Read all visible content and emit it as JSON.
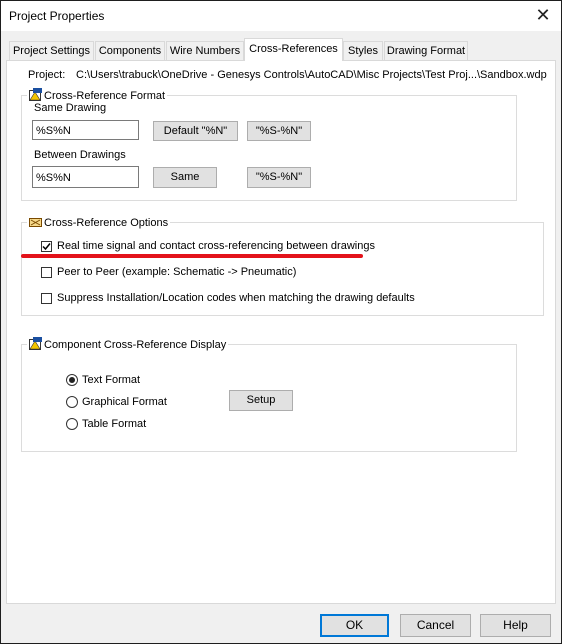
{
  "window": {
    "title": "Project Properties"
  },
  "tabs": [
    {
      "label": "Project Settings"
    },
    {
      "label": "Components"
    },
    {
      "label": "Wire Numbers"
    },
    {
      "label": "Cross-References"
    },
    {
      "label": "Styles"
    },
    {
      "label": "Drawing Format"
    }
  ],
  "active_tab": "Cross-References",
  "project": {
    "label": "Project:",
    "path": "C:\\Users\\trabuck\\OneDrive - Genesys Controls\\AutoCAD\\Misc Projects\\Test Proj...\\Sandbox.wdp"
  },
  "xref_format": {
    "legend": "Cross-Reference Format",
    "same_drawing_label": "Same Drawing",
    "same_drawing_value": "%S%N",
    "default_button": "Default \"%N\"",
    "same_alt_button": "\"%S-%N\"",
    "between_drawings_label": "Between Drawings",
    "between_drawings_value": "%S%N",
    "same_button": "Same",
    "between_alt_button": "\"%S-%N\""
  },
  "xref_options": {
    "legend": "Cross-Reference Options",
    "options": [
      {
        "label": "Real time signal and contact cross-referencing between drawings",
        "checked": true
      },
      {
        "label": "Peer to Peer (example: Schematic -> Pneumatic)",
        "checked": false
      },
      {
        "label": "Suppress Installation/Location codes when matching the drawing defaults",
        "checked": false
      }
    ]
  },
  "comp_display": {
    "legend": "Component Cross-Reference Display",
    "radios": [
      {
        "label": "Text Format",
        "selected": true
      },
      {
        "label": "Graphical Format",
        "selected": false
      },
      {
        "label": "Table Format",
        "selected": false
      }
    ],
    "setup_button": "Setup"
  },
  "footer": {
    "ok": "OK",
    "cancel": "Cancel",
    "help": "Help"
  },
  "annotation_color": "#e3121a"
}
